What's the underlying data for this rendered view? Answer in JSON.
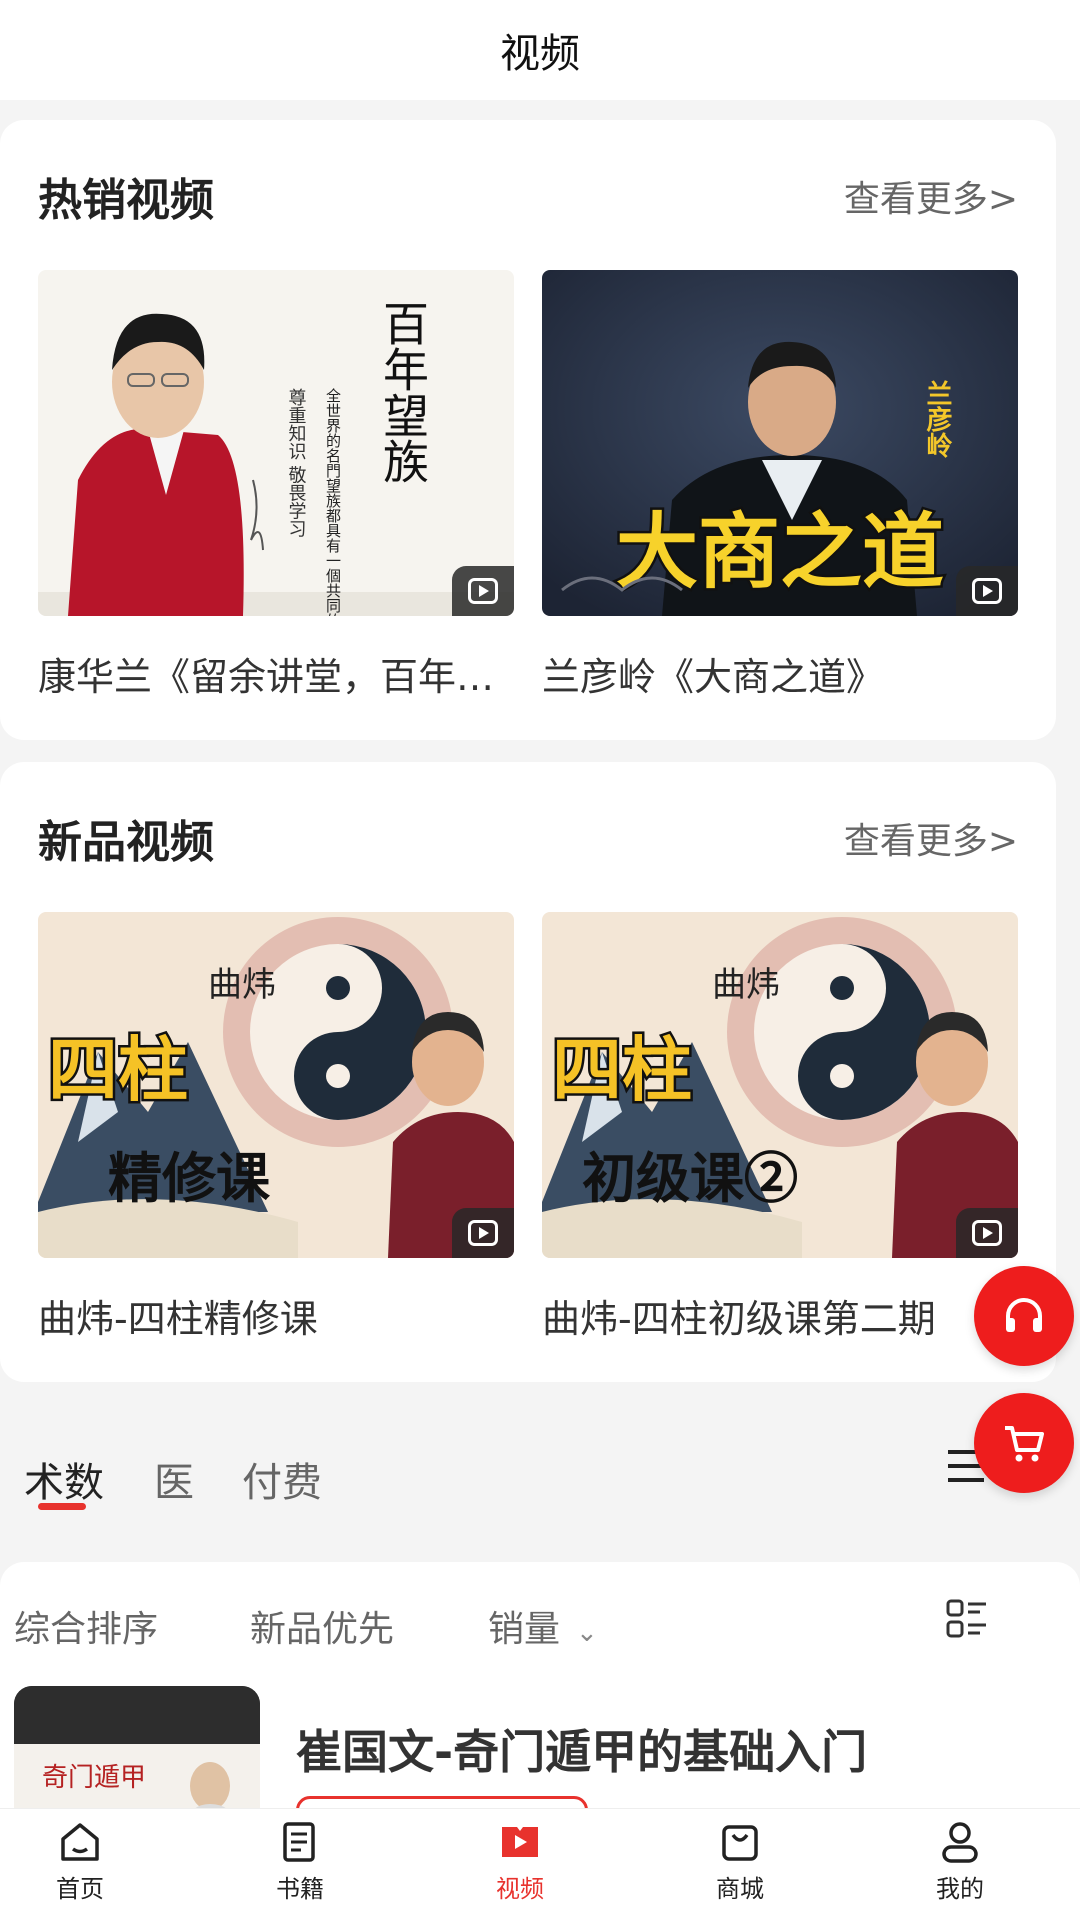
{
  "header": {
    "title": "视频"
  },
  "hot_section": {
    "title": "热销视频",
    "more_label": "查看更多>",
    "videos": [
      {
        "title": "康华兰《留余讲堂，百年望族》",
        "thumb_text": [
          "百年望族",
          "全世界的名門望族都具有一個共同的特徵：",
          "尊重知识 敬畏学习"
        ]
      },
      {
        "title": "兰彦岭《大商之道》",
        "thumb_text": [
          "兰彦岭",
          "大商之道"
        ]
      }
    ]
  },
  "new_section": {
    "title": "新品视频",
    "more_label": "查看更多>",
    "videos": [
      {
        "title": "曲炜-四柱精修课",
        "thumb_text": [
          "曲炜",
          "四柱",
          "精修课"
        ]
      },
      {
        "title": "曲炜-四柱初级课第二期",
        "thumb_text": [
          "曲炜",
          "四柱",
          "初级课②"
        ]
      }
    ]
  },
  "category_tabs": [
    {
      "label": "术数",
      "active": true
    },
    {
      "label": "医",
      "active": false
    },
    {
      "label": "付费",
      "active": false
    }
  ],
  "sort_bar": {
    "options": [
      "综合排序",
      "新品优先",
      "销量"
    ],
    "sales_chevron": "chevron-down-icon"
  },
  "list": [
    {
      "title": "崔国文-奇门遁甲的基础入门",
      "thumb_text": "奇门遁甲"
    }
  ],
  "fabs": {
    "headset": "headset-icon",
    "cart": "cart-icon"
  },
  "bottom_nav": [
    {
      "label": "首页",
      "icon": "home-icon",
      "active": false
    },
    {
      "label": "书籍",
      "icon": "book-icon",
      "active": false
    },
    {
      "label": "视频",
      "icon": "video-icon",
      "active": true
    },
    {
      "label": "商城",
      "icon": "shop-bag-icon",
      "active": false
    },
    {
      "label": "我的",
      "icon": "user-icon",
      "active": false
    }
  ],
  "colors": {
    "accent": "#e8322d",
    "fab": "#ee1d1d",
    "page_bg": "#f4f4f4"
  }
}
